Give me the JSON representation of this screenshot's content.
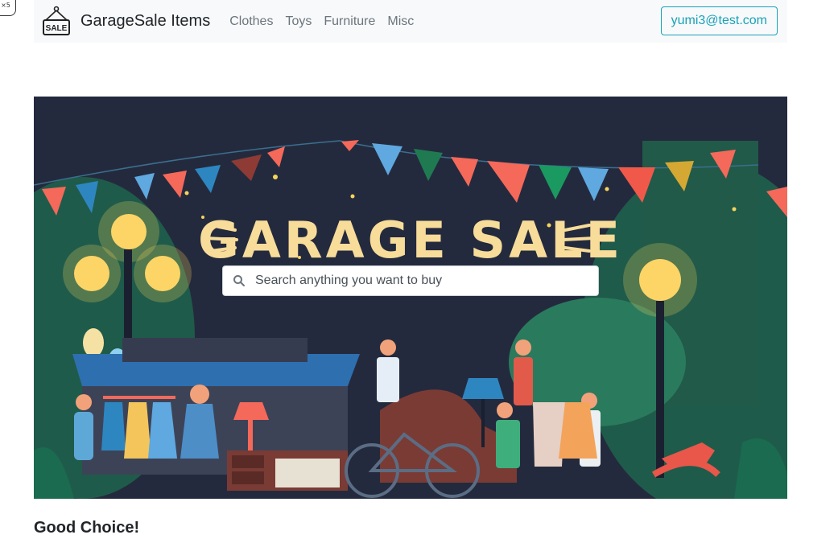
{
  "corner_tag": "×5",
  "navbar": {
    "brand": "GarageSale Items",
    "brand_icon": "sale-sign-icon",
    "links": [
      "Clothes",
      "Toys",
      "Furniture",
      "Misc"
    ],
    "user_email": "yumi3@test.com"
  },
  "hero": {
    "banner_title": "GARAGE SALE",
    "search": {
      "placeholder": "Search anything you want to buy",
      "icon": "search-icon"
    }
  },
  "footer": {
    "title": "Good Choice!"
  },
  "colors": {
    "accent": "#17a2b8",
    "nav_bg": "#f8f9fa",
    "hero_bg": "#242a3d",
    "banner_text": "#f7dc9a"
  }
}
